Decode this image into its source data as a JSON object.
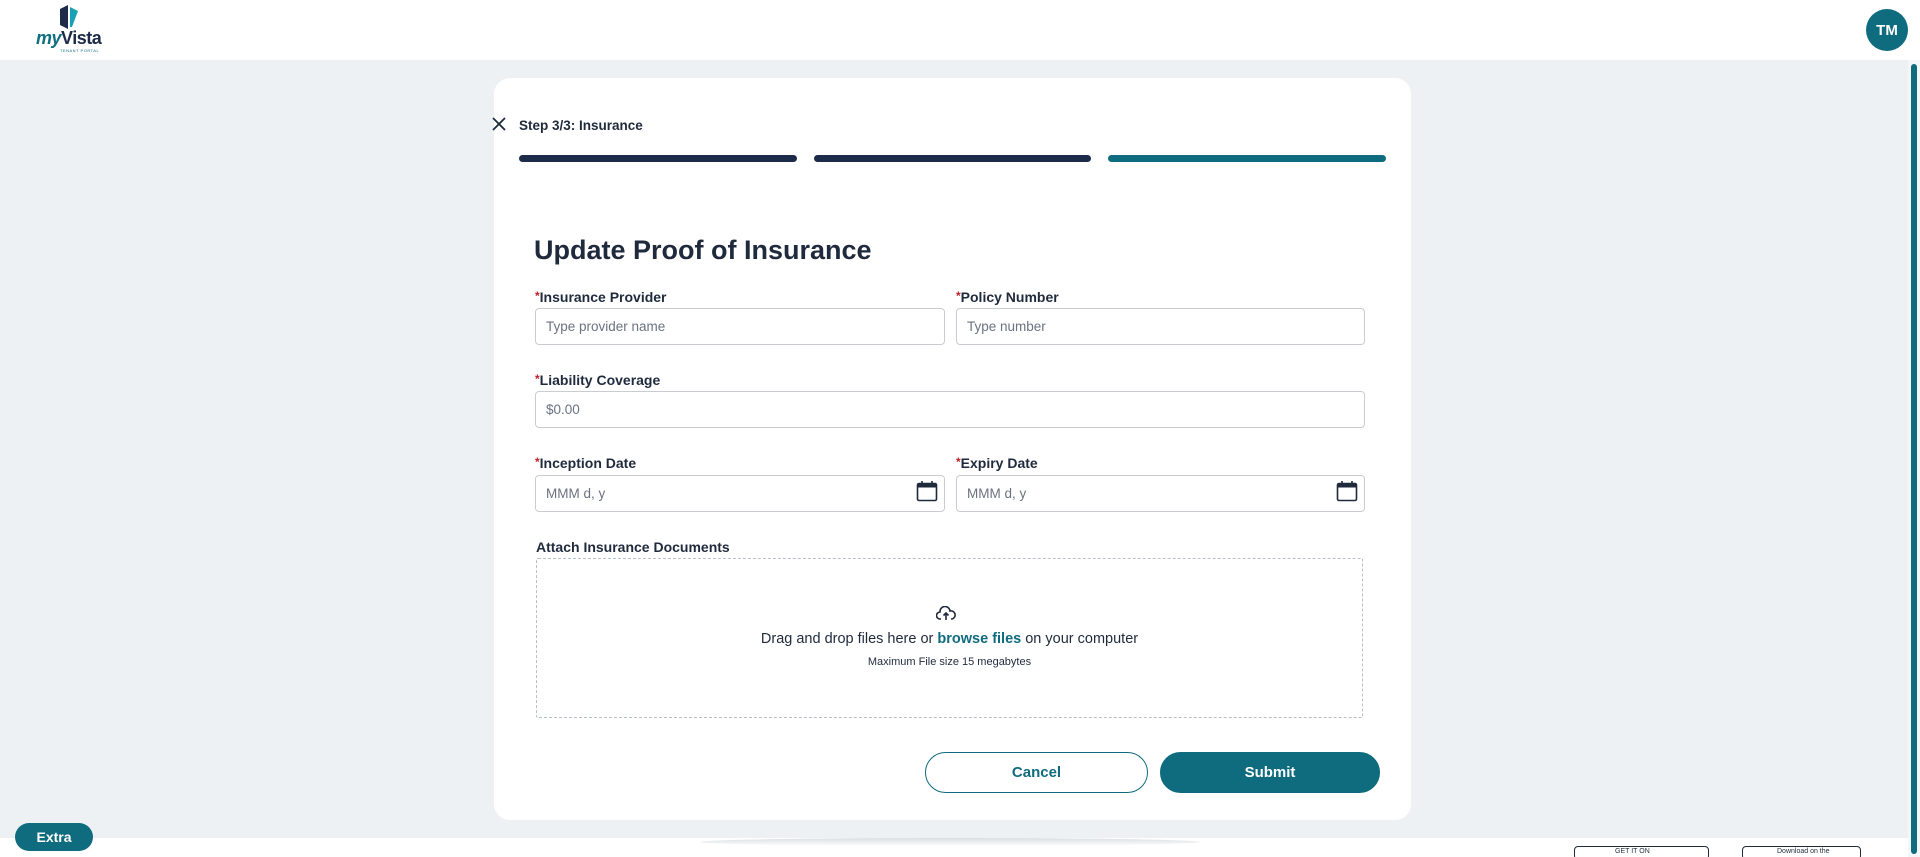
{
  "header": {
    "logo": {
      "brand_prefix": "my",
      "brand_name": "Vista",
      "tagline": "TENANT PORTAL"
    },
    "avatar_initials": "TM"
  },
  "wizard": {
    "step_label": "Step 3/3: Insurance",
    "steps_total": 3,
    "steps_completed": 3
  },
  "form": {
    "title": "Update Proof of Insurance",
    "required_marker": "*",
    "insurance_provider": {
      "label": "Insurance Provider",
      "placeholder": "Type provider name",
      "value": ""
    },
    "policy_number": {
      "label": "Policy Number",
      "placeholder": "Type number",
      "value": ""
    },
    "liability_coverage": {
      "label": "Liability Coverage",
      "placeholder": "$0.00",
      "value": ""
    },
    "inception_date": {
      "label": "Inception Date",
      "placeholder": "MMM d, y",
      "value": ""
    },
    "expiry_date": {
      "label": "Expiry Date",
      "placeholder": "MMM d, y",
      "value": ""
    },
    "attachments": {
      "label": "Attach Insurance Documents",
      "drop_text_before": "Drag and drop files here or ",
      "browse_link": "browse files",
      "drop_text_after": " on your computer",
      "max_size_text": "Maximum File size 15 megabytes"
    },
    "cancel_label": "Cancel",
    "submit_label": "Submit"
  },
  "extra_button_label": "Extra",
  "footer": {
    "store_badge_1": "GET IT ON",
    "store_badge_2": "Download on the"
  },
  "colors": {
    "accent": "#0f6b7e",
    "navy": "#1c2b4a",
    "required": "#c0202a",
    "page_background": "#eef1f3"
  }
}
